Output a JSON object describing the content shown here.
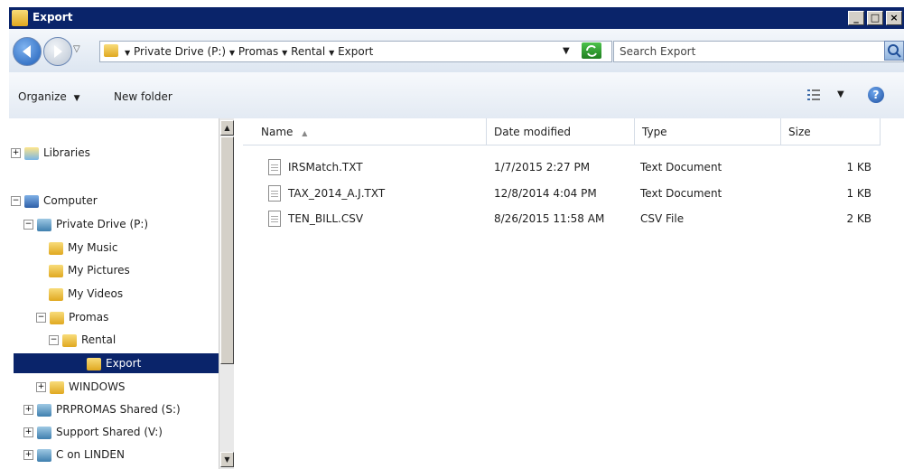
{
  "window": {
    "title": "Export"
  },
  "address": {
    "crumbs": [
      "Private Drive (P:)",
      "Promas",
      "Rental",
      "Export"
    ],
    "search_placeholder": "Search Export"
  },
  "toolbar": {
    "organize": "Organize",
    "new_folder": "New folder"
  },
  "nav": {
    "items": [
      {
        "label": "Libraries",
        "expander": "+",
        "icon": "libraries-icon"
      },
      {
        "label": "Computer",
        "expander": "−",
        "icon": "computer-icon"
      },
      {
        "label": "Private Drive (P:)",
        "expander": "−",
        "icon": "network-drive-icon"
      },
      {
        "label": "My Music",
        "expander": "",
        "icon": "folder-icon"
      },
      {
        "label": "My Pictures",
        "expander": "",
        "icon": "folder-icon"
      },
      {
        "label": "My Videos",
        "expander": "",
        "icon": "folder-icon"
      },
      {
        "label": "Promas",
        "expander": "−",
        "icon": "folder-icon"
      },
      {
        "label": "Rental",
        "expander": "−",
        "icon": "folder-icon"
      },
      {
        "label": "Export",
        "expander": "",
        "icon": "folder-icon",
        "selected": true
      },
      {
        "label": "WINDOWS",
        "expander": "+",
        "icon": "folder-icon"
      },
      {
        "label": "PRPROMAS Shared (S:)",
        "expander": "+",
        "icon": "network-drive-icon"
      },
      {
        "label": "Support Shared (V:)",
        "expander": "+",
        "icon": "network-drive-icon"
      },
      {
        "label": "C on LINDEN",
        "expander": "+",
        "icon": "network-drive-icon"
      }
    ]
  },
  "columns": {
    "name": "Name",
    "date": "Date modified",
    "type": "Type",
    "size": "Size"
  },
  "files": [
    {
      "name": "IRSMatch.TXT",
      "date": "1/7/2015 2:27 PM",
      "type": "Text Document",
      "size": "1 KB"
    },
    {
      "name": "TAX_2014_A.J.TXT",
      "date": "12/8/2014 4:04 PM",
      "type": "Text Document",
      "size": "1 KB"
    },
    {
      "name": "TEN_BILL.CSV",
      "date": "8/26/2015 11:58 AM",
      "type": "CSV File",
      "size": "2 KB"
    }
  ]
}
